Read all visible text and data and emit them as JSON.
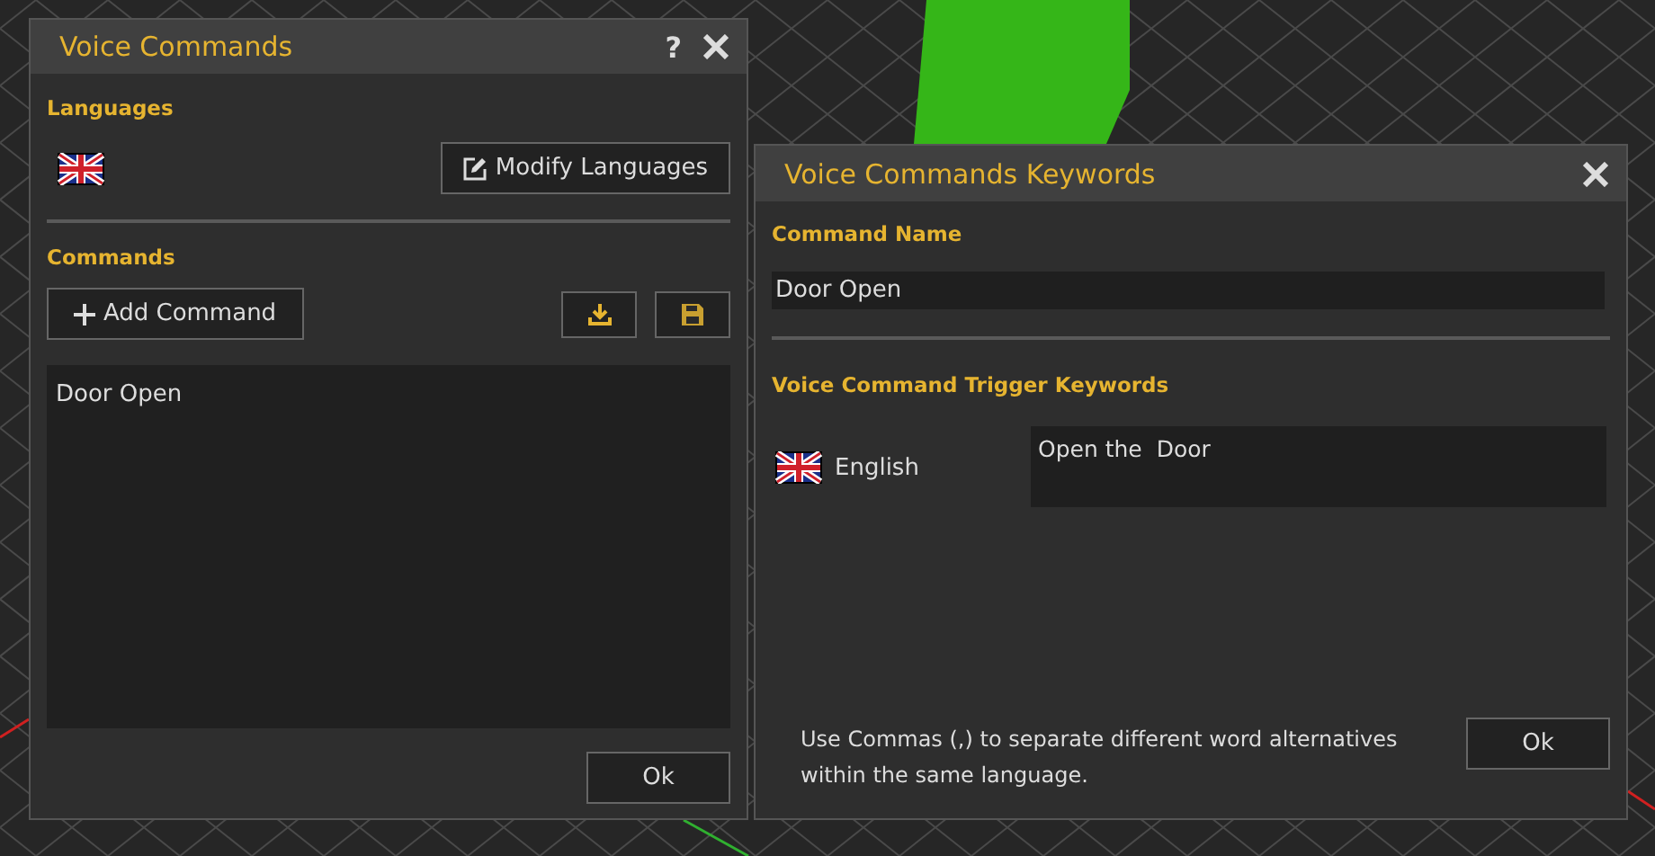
{
  "voice_commands_window": {
    "title": "Voice Commands",
    "help": "?",
    "languages": {
      "heading": "Languages",
      "modify_button": "Modify Languages"
    },
    "commands": {
      "heading": "Commands",
      "add_button": "Add Command",
      "items": [
        {
          "label": "Door Open"
        }
      ]
    },
    "ok_button": "Ok"
  },
  "keywords_window": {
    "title": "Voice Commands Keywords",
    "command_name": {
      "label": "Command Name",
      "value": "Door Open"
    },
    "trigger_heading": "Voice Command Trigger Keywords",
    "keywords": [
      {
        "language": "English",
        "value": "Open the  Door"
      }
    ],
    "hint": "Use Commas (,) to separate different word alternatives within the same language.",
    "ok_button": "Ok"
  }
}
